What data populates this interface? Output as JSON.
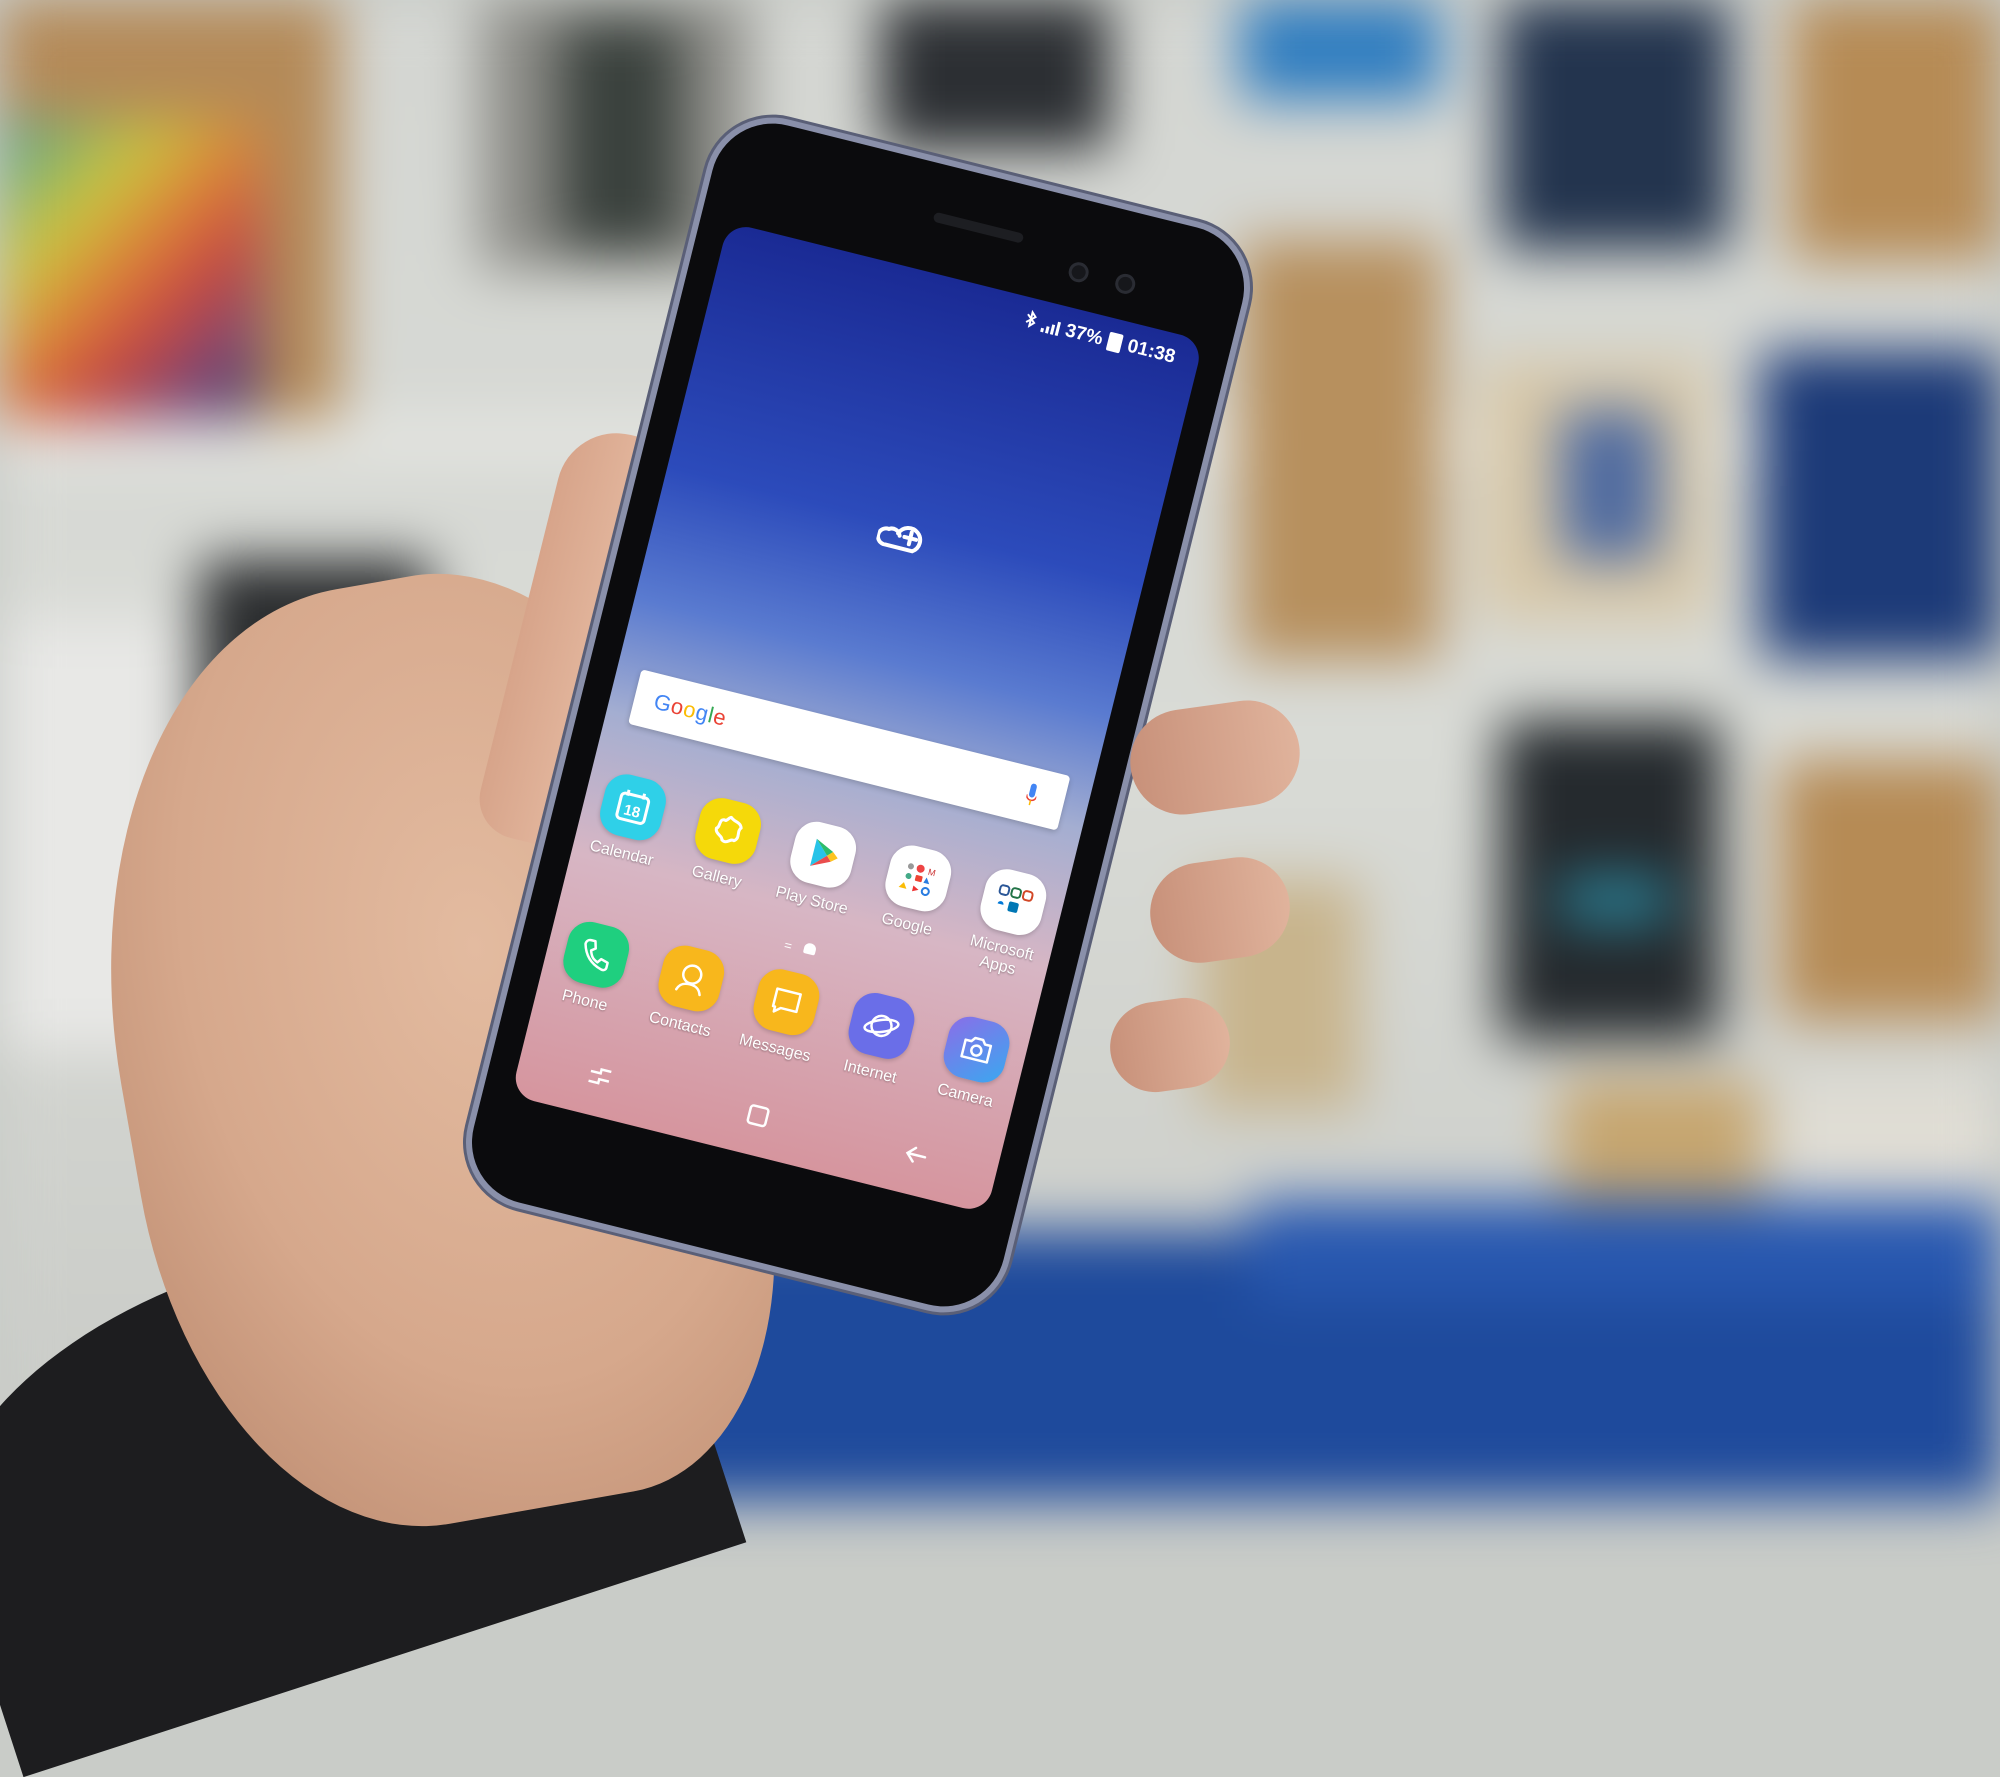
{
  "scene": {
    "description": "Hand holding a Samsung Galaxy phone showing the home screen against a blurred shelf background"
  },
  "status_bar": {
    "bluetooth_icon": "bluetooth-icon",
    "signal_icon": "signal-icon",
    "battery_percent": "37%",
    "battery_icon": "battery-icon",
    "time": "01:38"
  },
  "wallpaper": {
    "colors": [
      "#1a2a94",
      "#2c4bbb",
      "#a4aed1",
      "#d7b6c4",
      "#d6959e"
    ]
  },
  "widgets": {
    "add_cloud_icon": "cloud-plus-icon",
    "search": {
      "logo": "Google",
      "logo_colors": [
        "#4285F4",
        "#EA4335",
        "#FBBC05",
        "#4285F4",
        "#34A853",
        "#EA4335"
      ],
      "mic_icon": "microphone-icon"
    }
  },
  "apps_row1": [
    {
      "label": "Calendar",
      "icon": "calendar-icon",
      "badge": "18",
      "color": "#2fd0e8"
    },
    {
      "label": "Gallery",
      "icon": "gallery-flower-icon",
      "color": "#f5d90a"
    },
    {
      "label": "Play Store",
      "icon": "play-store-icon",
      "color": "#ffffff"
    },
    {
      "label": "Google",
      "icon": "google-folder-icon",
      "color": "#ffffff"
    },
    {
      "label": "Microsoft Apps",
      "icon": "microsoft-folder-icon",
      "color": "#ffffff"
    }
  ],
  "page_indicator": {
    "pages": 2,
    "current": 2
  },
  "dock": [
    {
      "label": "Phone",
      "icon": "phone-icon",
      "color": "#1fcf7f"
    },
    {
      "label": "Contacts",
      "icon": "contacts-icon",
      "color": "#f8b71c"
    },
    {
      "label": "Messages",
      "icon": "messages-icon",
      "color": "#f8b71c"
    },
    {
      "label": "Internet",
      "icon": "internet-planet-icon",
      "color": "#6a6ee8"
    },
    {
      "label": "Camera",
      "icon": "camera-icon",
      "color": "#4a8af0"
    }
  ],
  "navbar": {
    "recents": "recents-icon",
    "home": "home-icon",
    "back": "back-icon"
  }
}
